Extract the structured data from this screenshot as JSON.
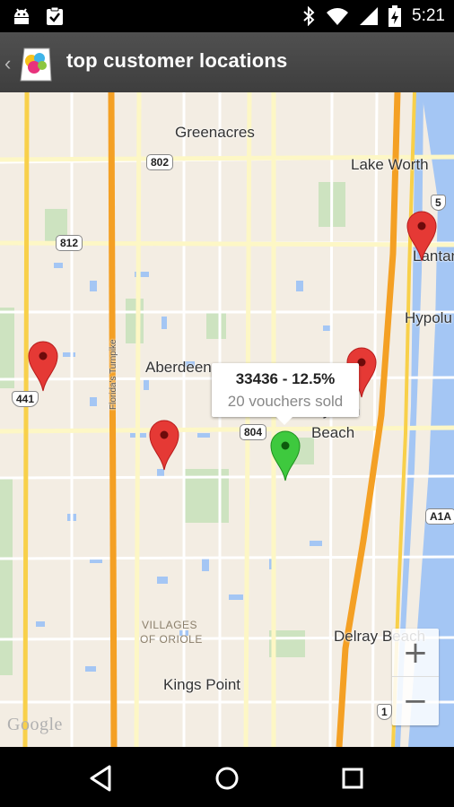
{
  "status_bar": {
    "time": "5:21",
    "left_icons": [
      "android-debug-icon",
      "clipboard-check-icon"
    ],
    "right_icons": [
      "bluetooth-icon",
      "wifi-icon",
      "signal-icon",
      "battery-charging-icon"
    ]
  },
  "action_bar": {
    "back_icon": "chevron-left-icon",
    "app_icon": "speech-bubbles-app-icon",
    "title": "top customer locations"
  },
  "map": {
    "labels": {
      "greenacres": "Greenacres",
      "lake_worth": "Lake Worth",
      "lantana": "Lantan",
      "hypoluxo": "Hypolu",
      "aberdeen": "Aberdeen",
      "boynton_1": "Boynton",
      "boynton_2": "Beach",
      "villages_1": "VILLAGES",
      "villages_2": "OF ORIOLE",
      "delray": "Delray Beach",
      "kings_point": "Kings Point",
      "turnpike": "Florida's Turnpike",
      "google": "Google"
    },
    "shields": {
      "r802": "802",
      "r812": "812",
      "r804": "804",
      "r5": "5",
      "r441": "441",
      "a1a": "A1A",
      "r1": "1"
    },
    "markers": [
      {
        "color": "red"
      },
      {
        "color": "red"
      },
      {
        "color": "red"
      },
      {
        "color": "red"
      },
      {
        "color": "green",
        "selected": true
      }
    ],
    "info_window": {
      "title": "33436 - 12.5%",
      "subtitle": "20 vouchers sold"
    },
    "zoom": {
      "in_label": "+",
      "out_label": "−"
    }
  },
  "nav_bar": {
    "back_icon": "back-triangle-icon",
    "home_icon": "home-circle-icon",
    "recents_icon": "recents-square-icon"
  },
  "colors": {
    "map_land": "#f3ede3",
    "highway": "#f4a024",
    "water": "#a4c6f4",
    "park": "#cde3c0",
    "marker_red": "#e53935",
    "marker_green": "#3ec93e"
  }
}
